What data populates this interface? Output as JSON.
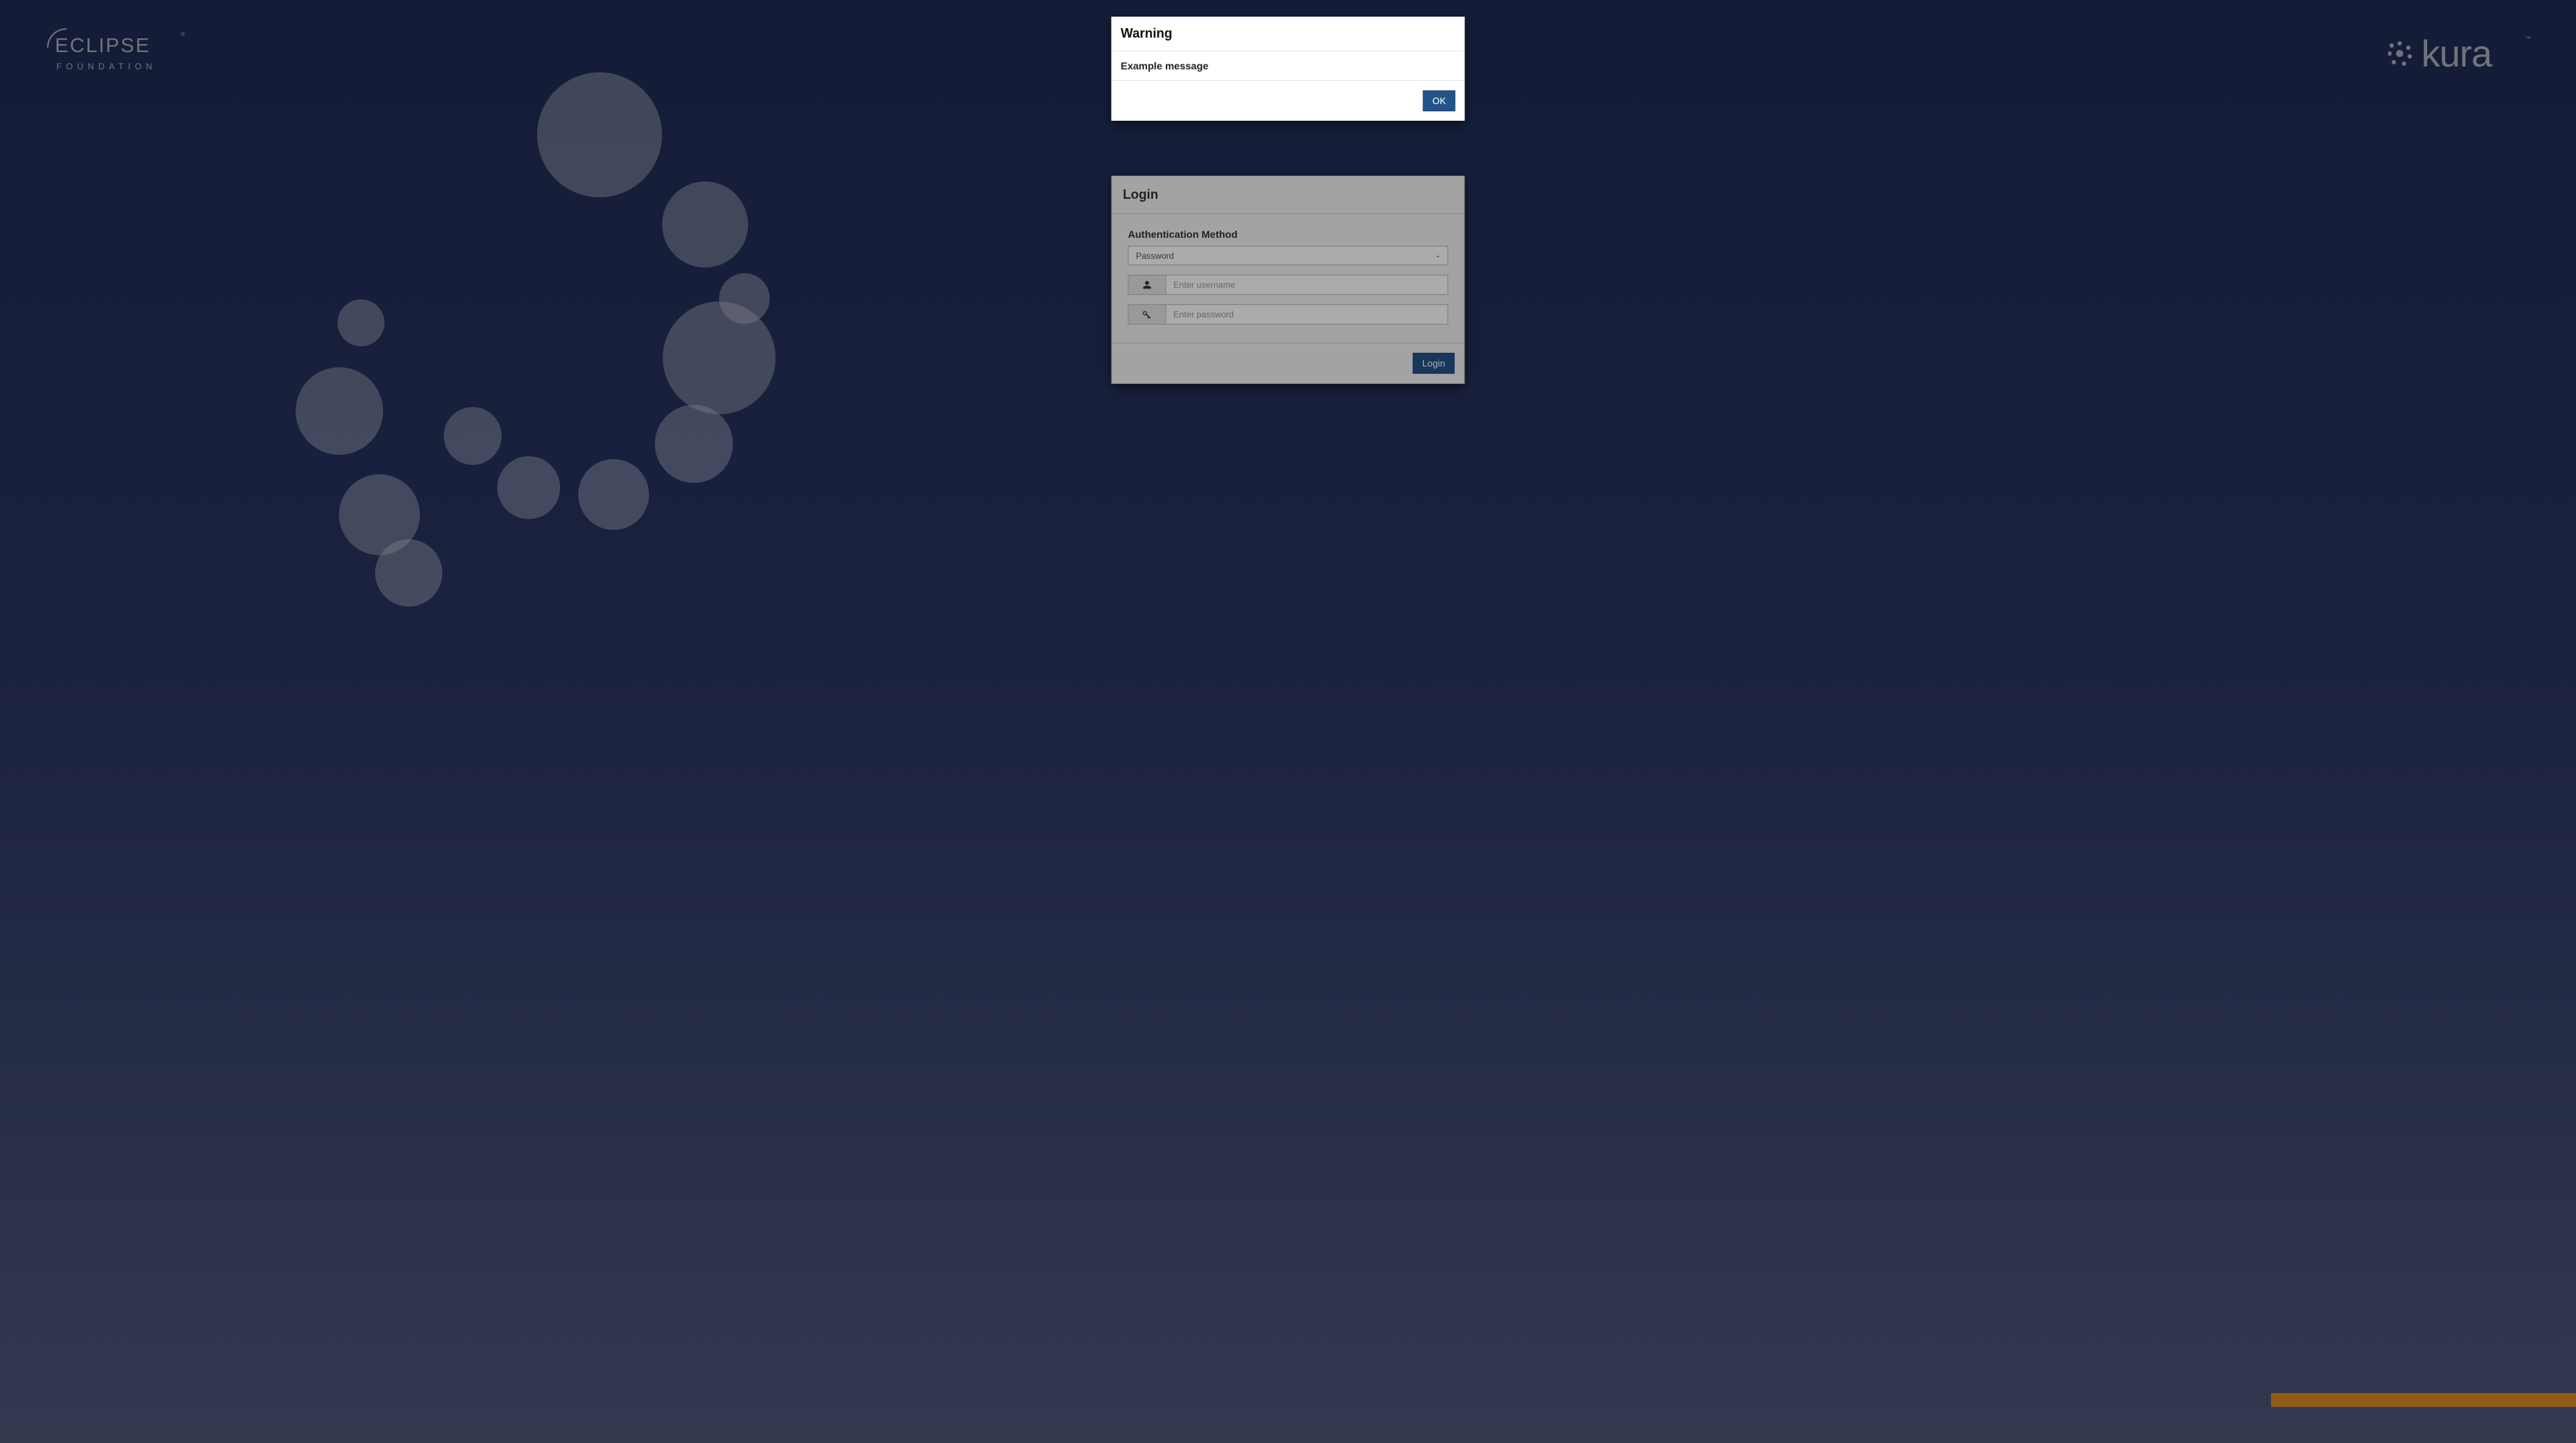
{
  "modal": {
    "title": "Warning",
    "message": "Example message",
    "ok_label": "OK"
  },
  "login": {
    "title": "Login",
    "auth_method_label": "Authentication Method",
    "auth_method_selected": "Password",
    "username_placeholder": "Enter username",
    "password_placeholder": "Enter password",
    "login_button_label": "Login"
  },
  "branding": {
    "left_logo": "Eclipse Foundation",
    "right_logo": "kura"
  },
  "colors": {
    "primary_button": "#245389",
    "accent_bar": "#d68a24",
    "background_top": "#1e2a52",
    "background_bottom": "#4d5577"
  }
}
